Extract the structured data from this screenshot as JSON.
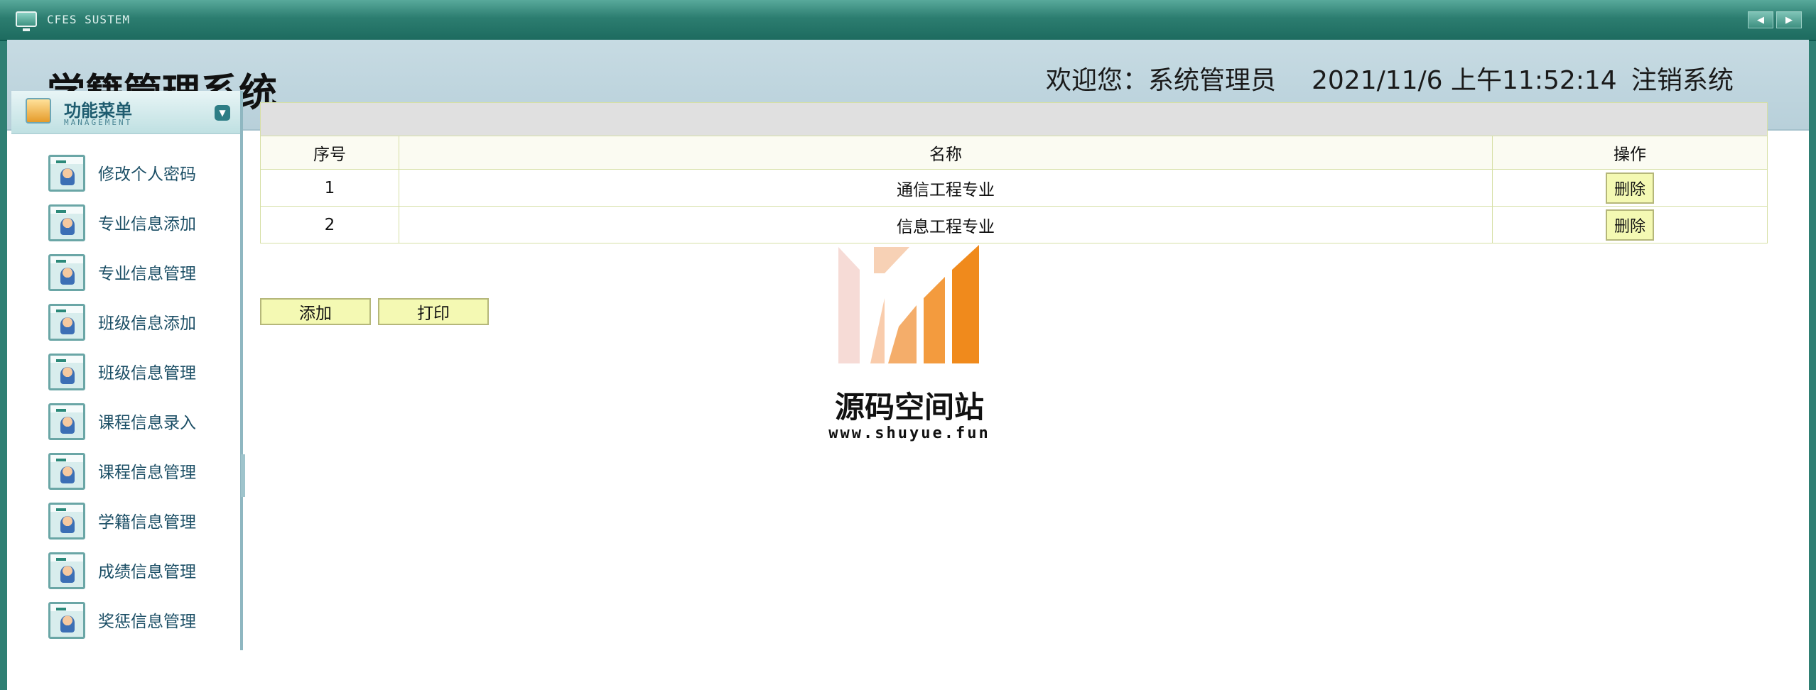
{
  "window": {
    "system_title": "CFES SUSTEM"
  },
  "header": {
    "app_title": "学籍管理系统",
    "welcome": "欢迎您：系统管理员",
    "datetime": "2021/11/6 上午11:52:14",
    "logout": "注销系统"
  },
  "sidebar": {
    "menu_title": "功能菜单",
    "menu_subtitle": "MANAGEMENT",
    "items": [
      {
        "label": "修改个人密码"
      },
      {
        "label": "专业信息添加"
      },
      {
        "label": "专业信息管理"
      },
      {
        "label": "班级信息添加"
      },
      {
        "label": "班级信息管理"
      },
      {
        "label": "课程信息录入"
      },
      {
        "label": "课程信息管理"
      },
      {
        "label": "学籍信息管理"
      },
      {
        "label": "成绩信息管理"
      },
      {
        "label": "奖惩信息管理"
      }
    ]
  },
  "table": {
    "headers": {
      "index": "序号",
      "name": "名称",
      "op": "操作"
    },
    "rows": [
      {
        "index": "1",
        "name": "通信工程专业",
        "action": "删除"
      },
      {
        "index": "2",
        "name": "信息工程专业",
        "action": "删除"
      }
    ]
  },
  "actions": {
    "add": "添加",
    "print": "打印"
  },
  "watermark": {
    "title": "源码空间站",
    "url": "www.shuyue.fun"
  },
  "colors": {
    "titlebar": "#2c7d70",
    "header_bg": "#c0d6df",
    "button_bg": "#f4f9b3",
    "table_border": "#d6dfa5",
    "watermark_orange": "#f08a1c"
  }
}
